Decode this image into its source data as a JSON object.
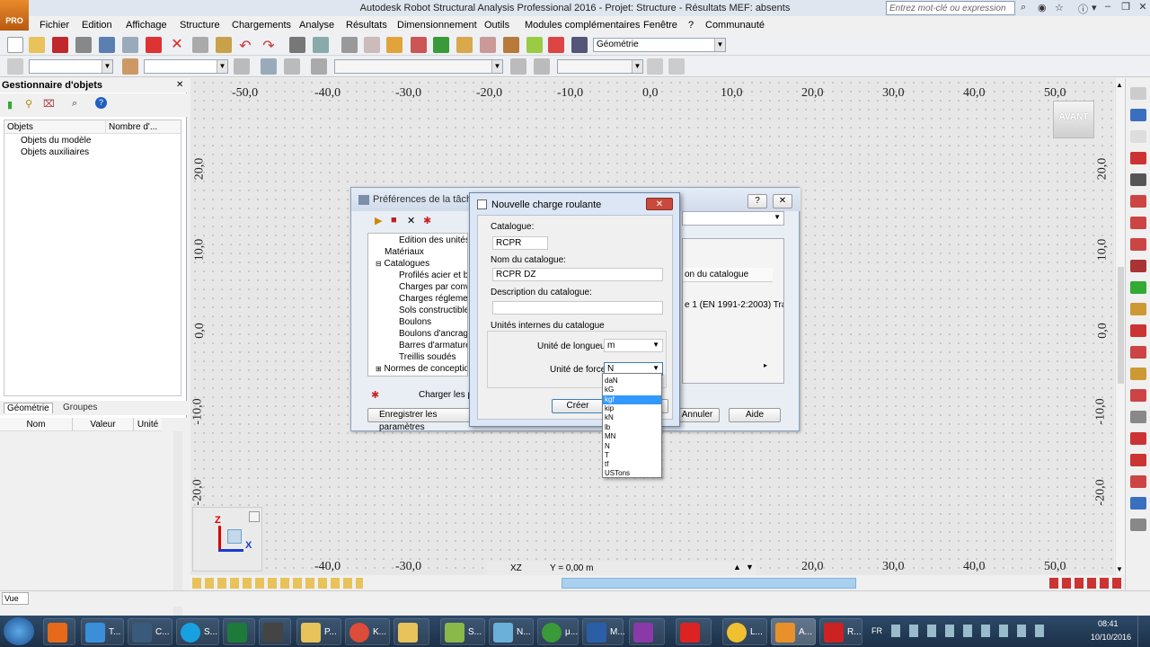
{
  "window": {
    "title": "Autodesk Robot Structural Analysis Professional 2016 - Projet: Structure - Résultats MEF: absents",
    "app_badge": "PRO",
    "search_placeholder": "Entrez mot-clé ou expression"
  },
  "menu": [
    "Fichier",
    "Edition",
    "Affichage",
    "Structure",
    "Chargements",
    "Analyse",
    "Résultats",
    "Dimensionnement",
    "Outils",
    "Modules complémentaires",
    "Fenêtre",
    "?",
    "Communauté"
  ],
  "toolbar": {
    "view_combo": "Géométrie"
  },
  "left_panel": {
    "title": "Gestionnaire d'objets",
    "tree_headers": [
      "Objets",
      "Nombre d'..."
    ],
    "tree_items": [
      "Objets du modèle",
      "Objets auxiliaires"
    ],
    "tabs": [
      "Géométrie",
      "Groupes"
    ],
    "grid_headers": [
      "Nom",
      "Valeur",
      "Unité"
    ]
  },
  "canvas": {
    "top_axis": [
      "-50,0",
      "-40,0",
      "-30,0",
      "-20,0",
      "-10,0",
      "0,0",
      "10,0",
      "20,0",
      "30,0",
      "40,0",
      "50,0"
    ],
    "bottom_axis": [
      "-50,0",
      "-40,0",
      "-30,0",
      "20,0",
      "30,0",
      "40,0",
      "50,0"
    ],
    "left_axis": [
      "20,0",
      "10,0",
      "0,0",
      "-10,0",
      "-20,0"
    ],
    "right_axis": [
      "20,0",
      "10,0",
      "0,0",
      "-10,0",
      "-20,0"
    ],
    "view_cube": "AVANT",
    "coord_plane": "XZ",
    "coord_readout": "Y = 0,00 m",
    "axis_labels": {
      "z": "Z",
      "x": "X"
    }
  },
  "prefs_dialog": {
    "title": "Préférences de la tâche",
    "tree": [
      {
        "label": "Edition des unités",
        "indent": 2
      },
      {
        "label": "Matériaux",
        "indent": 1
      },
      {
        "label": "Catalogues",
        "indent": 0
      },
      {
        "label": "Profilés acier et bo",
        "indent": 2
      },
      {
        "label": "Charges par conv",
        "indent": 2
      },
      {
        "label": "Charges réglemen",
        "indent": 2
      },
      {
        "label": "Sols constructibles",
        "indent": 2
      },
      {
        "label": "Boulons",
        "indent": 2
      },
      {
        "label": "Boulons d'ancrage",
        "indent": 2
      },
      {
        "label": "Barres d'armature",
        "indent": 2
      },
      {
        "label": "Treillis soudés",
        "indent": 2
      },
      {
        "label": "Normes de conception",
        "indent": 0
      }
    ],
    "table_header": "on du catalogue",
    "table_row": "e 1 (EN 1991-2:2003) Traf",
    "load_label": "Charger les par",
    "save_label": "Enregistrer les paramètres",
    "cancel": "Annuler",
    "help": "Aide"
  },
  "new_load_dialog": {
    "title": "Nouvelle charge roulante",
    "catalog_label": "Catalogue:",
    "catalog_value": "RCPR",
    "catalog_name_label": "Nom du catalogue:",
    "catalog_name_value": "RCPR DZ",
    "description_label": "Description du catalogue:",
    "description_value": "",
    "units_group": "Unités internes du catalogue",
    "length_unit_label": "Unité de longueur :",
    "length_unit_value": "m",
    "force_unit_label": "Unité de force :",
    "force_unit_value": "N",
    "create_button": "Créer",
    "force_options": [
      "daN",
      "kG",
      "kgf",
      "kip",
      "kN",
      "lb",
      "MN",
      "N",
      "T",
      "tf",
      "USTons"
    ],
    "highlighted_option": "kgf"
  },
  "status": {
    "view": "Vue"
  },
  "taskbar": {
    "apps": [
      "T...",
      "C...",
      "S...",
      "",
      "P...",
      "K...",
      "",
      "S...",
      "N...",
      "μ...",
      "M...",
      "",
      "",
      "L...",
      "A...",
      "R..."
    ],
    "lang": "FR",
    "time": "08:41",
    "date": "10/10/2016"
  }
}
